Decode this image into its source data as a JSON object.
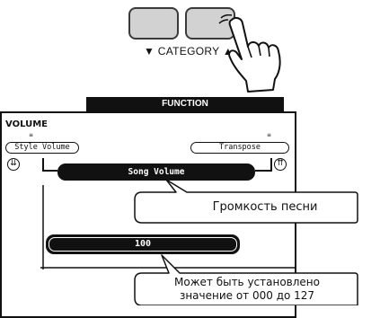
{
  "buttons": {
    "category_label": "▼ CATEGORY ▲"
  },
  "display": {
    "header": "FUNCTION",
    "section": "VOLUME",
    "left_item": "Style Volume",
    "right_item": "Transpose",
    "current_item": "Song Volume",
    "value": "100"
  },
  "callouts": {
    "song_volume": "Громкость песни",
    "range_line1": "Может быть установлено",
    "range_line2": "значение от 000 до 127"
  }
}
